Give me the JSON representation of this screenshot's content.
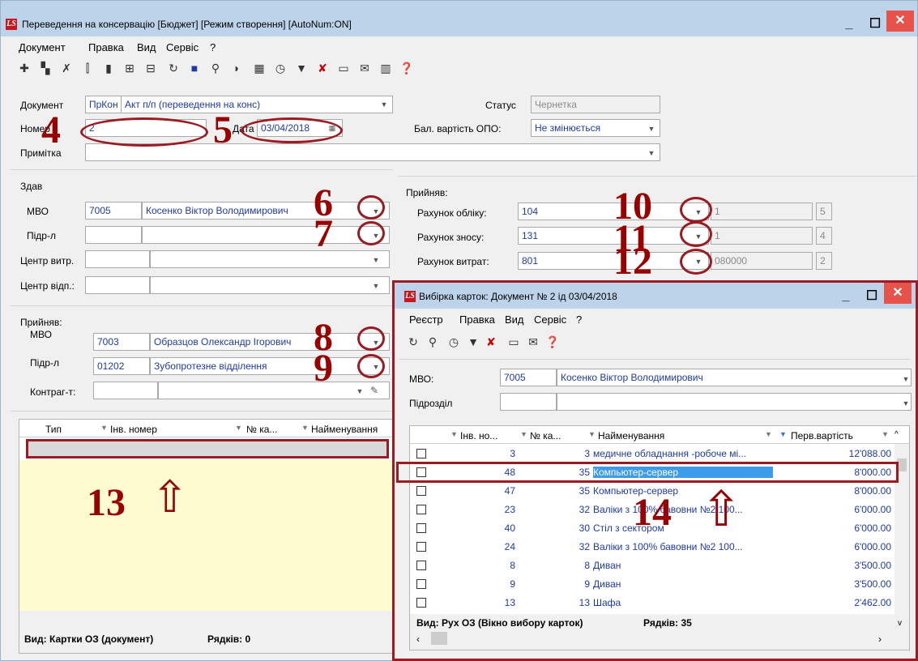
{
  "main": {
    "title": "Переведення на консервацію [Бюджет] [Режим створення] [AutoNum:ON]",
    "logo": "LS",
    "menu": [
      "Документ",
      "Правка",
      "Вид",
      "Сервіс",
      "?"
    ],
    "window_buttons": {
      "minimize": "_",
      "maximize": "☐",
      "close": "✕"
    }
  },
  "form": {
    "document_label": "Документ",
    "document_code": "ПрКон",
    "document_name": "Акт п/п (переведення на конс)",
    "status_label": "Статус",
    "status_value": "Чернетка",
    "number_label": "Номер",
    "number_value": "2",
    "date_label": "Дата",
    "date_value": "03/04/2018",
    "balance_label": "Бал. вартість ОПО:",
    "balance_value": "Не змінюється",
    "note_label": "Примітка",
    "note_value": ""
  },
  "handed": {
    "section_label": "Здав",
    "mvo_label": "МВО",
    "mvo_code": "7005",
    "mvo_name": "Косенко Віктор Володимирович",
    "dept_label": "Підр-л",
    "cost_center_label": "Центр витр.",
    "resp_center_label": "Центр відп.:"
  },
  "accounts": {
    "section_label": "Прийняв:",
    "acc1_label": "Рахунок обліку:",
    "acc1_value": "104",
    "acc1_extra": "1",
    "acc1_num": "5",
    "acc2_label": "Рахунок зносу:",
    "acc2_value": "131",
    "acc2_extra": "1",
    "acc2_num": "4",
    "acc3_label": "Рахунок витрат:",
    "acc3_value": "801",
    "acc3_extra": "080000",
    "acc3_num": "2"
  },
  "received": {
    "section_label": "Прийняв:",
    "mvo_label": "МВО",
    "mvo_code": "7003",
    "mvo_name": "Образцов Олександр Ігорович",
    "dept_label": "Підр-л",
    "dept_code": "01202",
    "dept_name": "Зубопротезне відділення",
    "contragent_label": "Контраг-т:"
  },
  "left_grid": {
    "columns": [
      "Тип",
      "Інв. номер",
      "№ ка...",
      "Найменування"
    ],
    "footer_view": "Вид: Картки ОЗ (документ)",
    "footer_rows": "Рядків: 0"
  },
  "annotations": [
    "4",
    "5",
    "6",
    "7",
    "8",
    "9",
    "10",
    "11",
    "12",
    "13",
    "14"
  ],
  "arrow_glyph": "⇧",
  "child": {
    "title": "Вибірка карток: Документ №  2     ід  03/04/2018",
    "menu": [
      "Реєстр",
      "Правка",
      "Вид",
      "Сервіс",
      "?"
    ],
    "mvo_label": "МВО:",
    "mvo_code": "7005",
    "mvo_name": "Косенко Віктор Володимирович",
    "dept_label": "Підрозділ",
    "columns": [
      "Інв. но...",
      "№ ка...",
      "Найменування",
      "Перв.вартість"
    ],
    "rows": [
      {
        "inv": "3",
        "card": "3",
        "name": "медичне обладнання -робоче мі...",
        "cost": "12'088.00"
      },
      {
        "inv": "48",
        "card": "35",
        "name": "Компьютер-сервер",
        "cost": "8'000.00"
      },
      {
        "inv": "47",
        "card": "35",
        "name": "Компьютер-сервер",
        "cost": "8'000.00"
      },
      {
        "inv": "23",
        "card": "32",
        "name": "Валіки з 100% бавовни №2 100...",
        "cost": "6'000.00"
      },
      {
        "inv": "40",
        "card": "30",
        "name": "Стіл з сектором",
        "cost": "6'000.00"
      },
      {
        "inv": "24",
        "card": "32",
        "name": "Валіки з 100% бавовни №2 100...",
        "cost": "6'000.00"
      },
      {
        "inv": "8",
        "card": "8",
        "name": "Диван",
        "cost": "3'500.00"
      },
      {
        "inv": "9",
        "card": "9",
        "name": "Диван",
        "cost": "3'500.00"
      },
      {
        "inv": "13",
        "card": "13",
        "name": "Шафа",
        "cost": "2'462.00"
      }
    ],
    "footer_view": "Вид: Рух ОЗ (Вікно вибору карток)",
    "footer_rows": "Рядків: 35"
  },
  "colors": {
    "accent": "#1f3aa8",
    "annotation": "#9b1b22",
    "selection": "#3d9be9",
    "close": "#e7524a"
  }
}
